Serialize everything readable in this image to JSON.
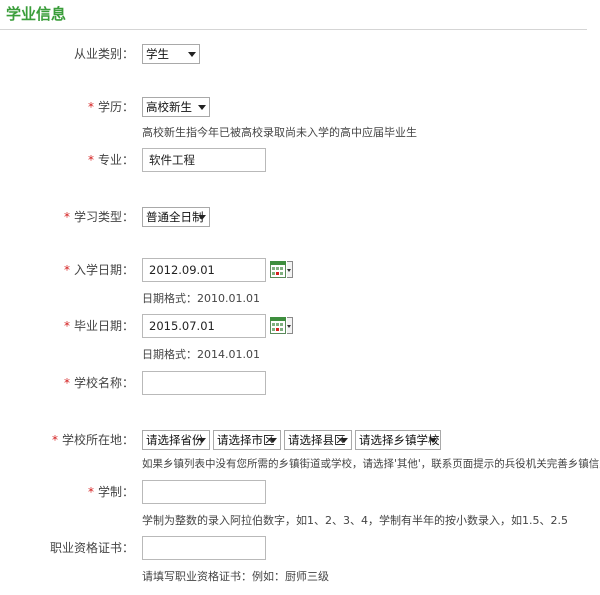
{
  "section": {
    "title": "学业信息"
  },
  "required_mark": "*",
  "colon": "：",
  "occupation": {
    "label": "从业类别",
    "value": "学生"
  },
  "education": {
    "label": "学历",
    "value": "高校新生",
    "hint": "高校新生指今年已被高校录取尚未入学的高中应届毕业生"
  },
  "major": {
    "label": "专业",
    "value": "软件工程"
  },
  "study_type": {
    "label": "学习类型",
    "value": "普通全日制"
  },
  "enroll_date": {
    "label": "入学日期",
    "value": "2012.09.01",
    "hint": "日期格式：2010.01.01"
  },
  "grad_date": {
    "label": "毕业日期",
    "value": "2015.07.01",
    "hint": "日期格式：2014.01.01"
  },
  "school_name": {
    "label": "学校名称",
    "value": ""
  },
  "school_location": {
    "label": "学校所在地",
    "province": "请选择省份",
    "city": "请选择市区",
    "county": "请选择县区",
    "town": "请选择乡镇学校",
    "hint": "如果乡镇列表中没有您所需的乡镇街道或学校，请选择'其他'，联系页面提示的兵役机关完善乡镇信息。"
  },
  "schooling_years": {
    "label": "学制",
    "value": "",
    "hint": "学制为整数的录入阿拉伯数字，如1、2、3、4，学制有半年的按小数录入，如1.5、2.5"
  },
  "qualification": {
    "label": "职业资格证书",
    "value": "",
    "hint": "请填写职业资格证书：例如：厨师三级"
  }
}
